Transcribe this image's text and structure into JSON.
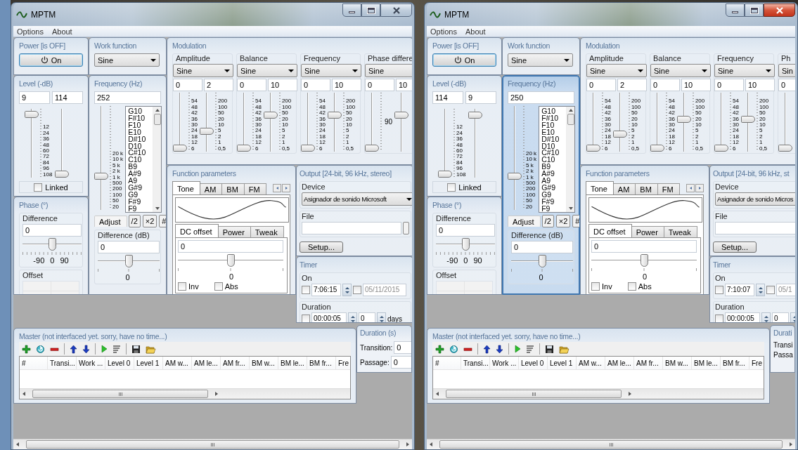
{
  "windows": [
    {
      "title": "MPTM",
      "active": false,
      "menu": [
        {
          "label": "Options"
        },
        {
          "label": "About"
        }
      ],
      "power": {
        "title": "Power [is OFF]",
        "button": "On"
      },
      "work_function": {
        "title": "Work function",
        "value": "Sine"
      },
      "modulation": {
        "title": "Modulation",
        "channels": [
          {
            "label": "Amplitude",
            "function": "Sine",
            "fields": [
              "0",
              "2"
            ],
            "sliders": [
              {
                "level": 0,
                "scale": [
                  "54",
                  "48",
                  "42",
                  "36",
                  "30",
                  "24",
                  "18",
                  "12",
                  "6"
                ]
              },
              {
                "level": 0.33,
                "scale": [
                  "200",
                  "100",
                  "50",
                  "20",
                  "10",
                  "5",
                  "2",
                  "1",
                  "0,5"
                ]
              }
            ]
          },
          {
            "label": "Balance",
            "function": "Sine",
            "fields": [
              "0",
              "10"
            ],
            "sliders": [
              {
                "level": 0,
                "scale": [
                  "54",
                  "48",
                  "42",
                  "36",
                  "30",
                  "24",
                  "18",
                  "12",
                  "6"
                ]
              },
              {
                "level": 0.63,
                "scale": [
                  "200",
                  "100",
                  "50",
                  "20",
                  "10",
                  "5",
                  "2",
                  "1",
                  "0,5"
                ]
              }
            ]
          },
          {
            "label": "Frequency",
            "function": "Sine",
            "fields": [
              "0",
              "10"
            ],
            "sliders": [
              {
                "level": 0,
                "scale": [
                  "54",
                  "48",
                  "42",
                  "36",
                  "30",
                  "24",
                  "18",
                  "12",
                  "6"
                ]
              },
              {
                "level": 0.63,
                "scale": [
                  "200",
                  "100",
                  "50",
                  "20",
                  "10",
                  "5",
                  "2",
                  "1",
                  "0,5"
                ]
              }
            ]
          },
          {
            "label": "Phase differe",
            "function": "Sine",
            "fields": [
              "0",
              "10"
            ],
            "sliders": [
              {
                "level": 0,
                "scale": [
                  "90"
                ]
              },
              {
                "level": 0.63
              }
            ]
          }
        ]
      },
      "level": {
        "title": "Level (-dB)",
        "fields": [
          "9",
          "114"
        ],
        "sliders": [
          {
            "level": 0.97,
            "scale": [
              "12",
              "24",
              "36",
              "48",
              "60",
              "72",
              "84",
              "96",
              "108"
            ]
          },
          {
            "level": 0
          }
        ],
        "linked": {
          "label": "Linked",
          "checked": false
        }
      },
      "frequency": {
        "title": "Frequency (Hz)",
        "highlighted": false,
        "value": "252",
        "slider": {
          "level": 0.31,
          "scale": [
            "20 k",
            "10 k",
            "5 k",
            "2 k",
            "1 k",
            "500",
            "200",
            "100",
            "50",
            "20"
          ]
        },
        "notes": [
          "G10",
          "F#10",
          "F10",
          "E10",
          "D#10",
          "D10",
          "C#10",
          "C10",
          "B9",
          "A#9",
          "A9",
          "G#9",
          "G9",
          "F#9",
          "F9"
        ],
        "buttons": [
          {
            "label": "Adjust",
            "kind": "tab"
          },
          {
            "label": "/2",
            "kind": "button"
          },
          {
            "label": "×2",
            "kind": "button"
          },
          {
            "label": "#",
            "kind": "button"
          }
        ],
        "difference": {
          "label": "Difference (dB)",
          "value": "0",
          "slider": {
            "level": 0.5
          },
          "reading": "0"
        }
      },
      "phase": {
        "title": "Phase (°)",
        "difference": {
          "label": "Difference",
          "value": "0",
          "slider": {
            "level": 0.5
          },
          "scale": [
            "-90",
            "0",
            "90"
          ]
        },
        "offset": {
          "label": "Offset"
        }
      },
      "function_parameters": {
        "title": "Function parameters",
        "tabs": [
          {
            "label": "Tone",
            "selected": true
          },
          {
            "label": "AM",
            "selected": false
          },
          {
            "label": "BM",
            "selected": false
          },
          {
            "label": "FM",
            "selected": false
          }
        ],
        "subtabs": [
          {
            "label": "DC offset",
            "selected": true
          },
          {
            "label": "Power",
            "selected": false
          },
          {
            "label": "Tweak",
            "selected": false
          }
        ],
        "value": "0",
        "slider": {
          "level": 0.5
        },
        "reading": "0",
        "checkboxes": [
          {
            "label": "Inv",
            "checked": false
          },
          {
            "label": "Abs",
            "checked": false
          }
        ]
      },
      "output": {
        "title": "Output [24-bit, 96 kHz, stereo]",
        "device": {
          "label": "Device",
          "value": "Asignador de sonido Microsoft"
        },
        "file": {
          "label": "File",
          "browse_button": true
        },
        "setup": "Setup..."
      },
      "timer": {
        "title": "Timer",
        "on": {
          "label": "On",
          "checked": false,
          "time": "7:06:15",
          "date_checked": false,
          "date": "05/11/2015"
        },
        "duration": {
          "label": "Duration",
          "checked": false,
          "time": "00:00:05",
          "count": "0",
          "unit": "days"
        }
      },
      "master": {
        "title": "Master (not interfaced yet. sorry, have no time...)",
        "columns": [
          "#",
          "Transi...",
          "Work ...",
          "Level 0",
          "Level 1",
          "AM w...",
          "AM le...",
          "AM fr...",
          "BM w...",
          "BM le...",
          "BM fr...",
          "Fre"
        ]
      },
      "duration": {
        "title": "Duration (s)",
        "rows": [
          {
            "label": "Transition:",
            "value": "0"
          },
          {
            "label": "Passage:",
            "value": "0"
          }
        ]
      }
    },
    {
      "title": "MPTM",
      "active": true,
      "menu": [
        {
          "label": "Options"
        },
        {
          "label": "About"
        }
      ],
      "power": {
        "title": "Power [is OFF]",
        "button": "On"
      },
      "work_function": {
        "title": "Work function",
        "value": "Sine"
      },
      "modulation": {
        "title": "Modulation",
        "channels": [
          {
            "label": "Amplitude",
            "function": "Sine",
            "fields": [
              "0",
              "2"
            ],
            "sliders": [
              {
                "level": 0,
                "scale": [
                  "54",
                  "48",
                  "42",
                  "36",
                  "30",
                  "24",
                  "18",
                  "12",
                  "6"
                ]
              },
              {
                "level": 0.27,
                "scale": [
                  "200",
                  "100",
                  "50",
                  "20",
                  "10",
                  "5",
                  "2",
                  "1",
                  "0,5"
                ]
              }
            ]
          },
          {
            "label": "Balance",
            "function": "Sine",
            "fields": [
              "0",
              "10"
            ],
            "sliders": [
              {
                "level": 0,
                "scale": [
                  "54",
                  "48",
                  "42",
                  "36",
                  "30",
                  "24",
                  "18",
                  "12",
                  "6"
                ]
              },
              {
                "level": 0.55,
                "scale": [
                  "200",
                  "100",
                  "50",
                  "20",
                  "10",
                  "5",
                  "2",
                  "1",
                  "0,5"
                ]
              }
            ]
          },
          {
            "label": "Frequency",
            "function": "Sine",
            "fields": [
              "0",
              "10"
            ],
            "sliders": [
              {
                "level": 0,
                "scale": [
                  "54",
                  "48",
                  "42",
                  "36",
                  "30",
                  "24",
                  "18",
                  "12",
                  "6"
                ]
              },
              {
                "level": 0.55,
                "scale": [
                  "200",
                  "100",
                  "50",
                  "20",
                  "10",
                  "5",
                  "2",
                  "1",
                  "0,5"
                ]
              }
            ]
          },
          {
            "label": "Ph",
            "function": "Sin",
            "fields": [
              "0"
            ],
            "sliders": [
              {
                "level": 0
              }
            ]
          }
        ]
      },
      "level": {
        "title": "Level (-dB)",
        "fields": [
          "114",
          "9"
        ],
        "sliders": [
          {
            "level": 0,
            "scale": [
              "12",
              "24",
              "36",
              "48",
              "60",
              "72",
              "84",
              "96",
              "108"
            ]
          },
          {
            "level": 0.95
          }
        ],
        "linked": {
          "label": "Linked",
          "checked": false
        }
      },
      "frequency": {
        "title": "Frequency (Hz)",
        "highlighted": true,
        "value": "250",
        "slider": {
          "level": 0.31,
          "scale": [
            "20 k",
            "10 k",
            "5 k",
            "2 k",
            "1 k",
            "500",
            "200",
            "100",
            "50",
            "20"
          ]
        },
        "notes": [
          "G10",
          "F#10",
          "F10",
          "E10",
          "D#10",
          "D10",
          "C#10",
          "C10",
          "B9",
          "A#9",
          "A9",
          "G#9",
          "G9",
          "F#9",
          "F9"
        ],
        "buttons": [
          {
            "label": "Adjust",
            "kind": "tab"
          },
          {
            "label": "/2",
            "kind": "button"
          },
          {
            "label": "×2",
            "kind": "button"
          },
          {
            "label": "#",
            "kind": "button"
          }
        ],
        "difference": {
          "label": "Difference (dB)",
          "value": "0",
          "slider": {
            "level": 0.5
          },
          "reading": "0"
        }
      },
      "phase": {
        "title": "Phase (°)",
        "difference": {
          "label": "Difference",
          "value": "0",
          "slider": {
            "level": 0.5
          },
          "scale": [
            "-90",
            "0",
            "90"
          ]
        },
        "offset": {
          "label": "Offset"
        }
      },
      "function_parameters": {
        "title": "Function parameters",
        "tabs": [
          {
            "label": "Tone",
            "selected": true
          },
          {
            "label": "AM",
            "selected": false
          },
          {
            "label": "BM",
            "selected": false
          },
          {
            "label": "FM",
            "selected": false
          }
        ],
        "subtabs": [
          {
            "label": "DC offset",
            "selected": true
          },
          {
            "label": "Power",
            "selected": false
          },
          {
            "label": "Tweak",
            "selected": false
          }
        ],
        "value": "0",
        "slider": {
          "level": 0.5
        },
        "reading": "0",
        "checkboxes": [
          {
            "label": "Inv",
            "checked": false
          },
          {
            "label": "Abs",
            "checked": false
          }
        ]
      },
      "output": {
        "title": "Output [24-bit, 96 kHz, st",
        "device": {
          "label": "Device",
          "value": "Asignador de sonido Micros"
        },
        "file": {
          "label": "File"
        },
        "setup": "Setup..."
      },
      "timer": {
        "title": "Timer",
        "on": {
          "label": "On",
          "checked": false,
          "time": "7:10:07",
          "date_checked": false,
          "date": "05/1"
        },
        "duration": {
          "label": "Duration",
          "checked": false,
          "time": "00:00:05",
          "count": "0"
        }
      },
      "master": {
        "title": "Master (not interfaced yet. sorry, have no time...)",
        "columns": [
          "#",
          "Transi...",
          "Work ...",
          "Level 0",
          "Level 1",
          "AM w...",
          "AM le...",
          "AM fr...",
          "BM w...",
          "BM le...",
          "BM fr...",
          "Fre"
        ]
      },
      "duration": {
        "title": "Durati",
        "rows": [
          {
            "label": "Transi"
          },
          {
            "label": "Passa"
          }
        ]
      }
    }
  ]
}
